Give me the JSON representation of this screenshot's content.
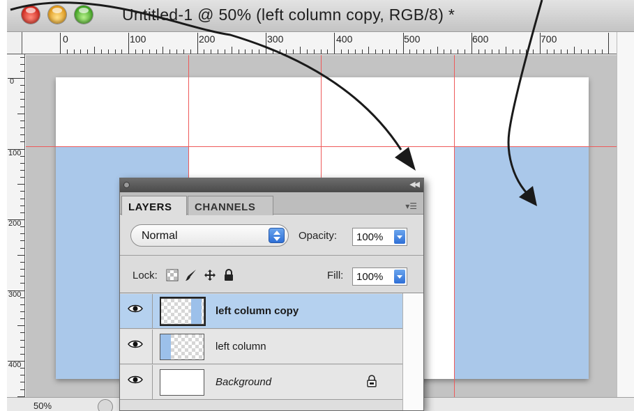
{
  "window": {
    "title": "Untitled-1 @ 50% (left column copy, RGB/8) *"
  },
  "rulers": {
    "horizontal": [
      "0",
      "100",
      "200",
      "300",
      "400",
      "500",
      "600",
      "700"
    ],
    "vertical": [
      "0",
      "100",
      "200",
      "300",
      "400"
    ]
  },
  "canvas": {
    "column_color": "#aac8ea",
    "guide_color": "#ee5a5a"
  },
  "status": {
    "zoom": "50%"
  },
  "layers_panel": {
    "tabs": [
      "LAYERS",
      "CHANNELS"
    ],
    "blend_mode": "Normal",
    "opacity_label": "Opacity:",
    "opacity_value": "100%",
    "lock_label": "Lock:",
    "fill_label": "Fill:",
    "fill_value": "100%",
    "layers": [
      {
        "name": "left column copy",
        "selected": true
      },
      {
        "name": "left column",
        "selected": false
      },
      {
        "name": "Background",
        "selected": false,
        "locked": true
      }
    ]
  }
}
